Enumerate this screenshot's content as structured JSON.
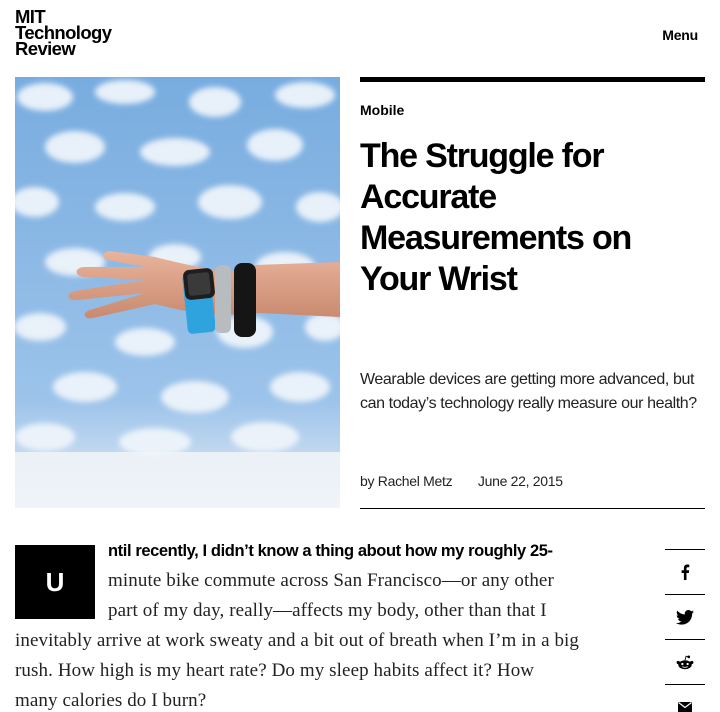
{
  "brand": {
    "line1": "MIT",
    "line2": "Technology",
    "line3": "Review"
  },
  "nav": {
    "menu_label": "Menu"
  },
  "hero": {
    "alt": "Hand wearing several fitness wristbands against a sky of clouds"
  },
  "article": {
    "category": "Mobile",
    "headline": "The Struggle for Accurate Measurements on Your Wrist",
    "dek": "Wearable devices are getting more advanced, but can today’s technology really measure our health?",
    "author_prefix": "by",
    "author": "Rachel Metz",
    "date": "June 22, 2015",
    "dropcap": "U",
    "lead": "ntil recently, I didn’t know a thing about how my roughly 25-",
    "body_lines": [
      "minute bike commute across San Francisco—or any other",
      "part of my day, really—affects my body, other than that I",
      "inevitably arrive at work sweaty and a bit out of breath when I’m in a big",
      "rush. How high is my heart rate? Do my sleep habits affect it? How",
      "many calories do I burn?"
    ]
  },
  "share": [
    {
      "icon": "facebook-icon"
    },
    {
      "icon": "twitter-icon"
    },
    {
      "icon": "reddit-icon"
    },
    {
      "icon": "email-icon"
    }
  ],
  "colors": {
    "text": "#000000",
    "body": "#222222",
    "sky": "#7fb3e4"
  }
}
